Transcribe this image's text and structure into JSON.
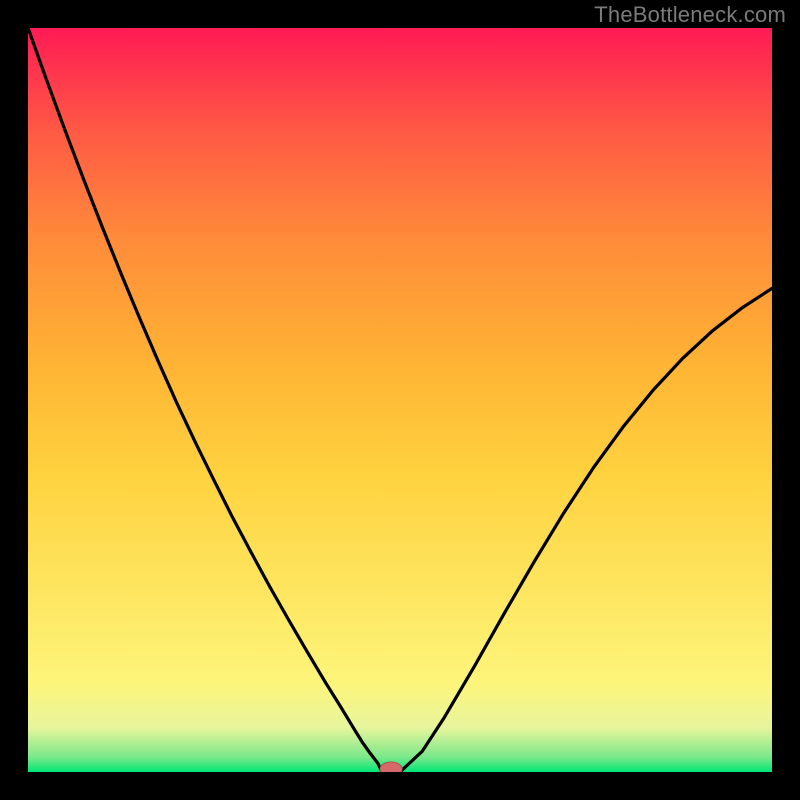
{
  "watermark": "TheBottleneck.com",
  "colors": {
    "frame": "#000000",
    "curve": "#000000",
    "marker_fill": "#d66a6a",
    "marker_stroke": "#b05050",
    "gradient_stops": [
      {
        "offset": 0.0,
        "color": "#00e676"
      },
      {
        "offset": 0.02,
        "color": "#7be88a"
      },
      {
        "offset": 0.06,
        "color": "#e8f59c"
      },
      {
        "offset": 0.12,
        "color": "#fdf57a"
      },
      {
        "offset": 0.4,
        "color": "#ffd23f"
      },
      {
        "offset": 0.55,
        "color": "#ffb334"
      },
      {
        "offset": 0.72,
        "color": "#ff8a3a"
      },
      {
        "offset": 0.86,
        "color": "#ff5a45"
      },
      {
        "offset": 1.0,
        "color": "#ff1b54"
      }
    ]
  },
  "chart_data": {
    "type": "line",
    "title": "",
    "xlabel": "",
    "ylabel": "",
    "xlim": [
      0,
      1
    ],
    "ylim": [
      0,
      1
    ],
    "x": [
      0.0,
      0.025,
      0.05,
      0.075,
      0.1,
      0.125,
      0.15,
      0.175,
      0.2,
      0.225,
      0.25,
      0.275,
      0.3,
      0.325,
      0.35,
      0.375,
      0.4,
      0.42,
      0.44,
      0.45,
      0.46,
      0.47,
      0.476,
      0.5,
      0.53,
      0.56,
      0.6,
      0.64,
      0.68,
      0.72,
      0.76,
      0.8,
      0.84,
      0.88,
      0.92,
      0.96,
      1.0
    ],
    "values": [
      1.0,
      0.93,
      0.862,
      0.796,
      0.732,
      0.67,
      0.61,
      0.552,
      0.496,
      0.443,
      0.392,
      0.342,
      0.295,
      0.249,
      0.205,
      0.162,
      0.12,
      0.088,
      0.055,
      0.039,
      0.025,
      0.012,
      0.0,
      0.0,
      0.028,
      0.074,
      0.142,
      0.213,
      0.282,
      0.348,
      0.409,
      0.464,
      0.513,
      0.556,
      0.593,
      0.624,
      0.65
    ],
    "marker": {
      "x": 0.488,
      "y": 0.0
    }
  }
}
